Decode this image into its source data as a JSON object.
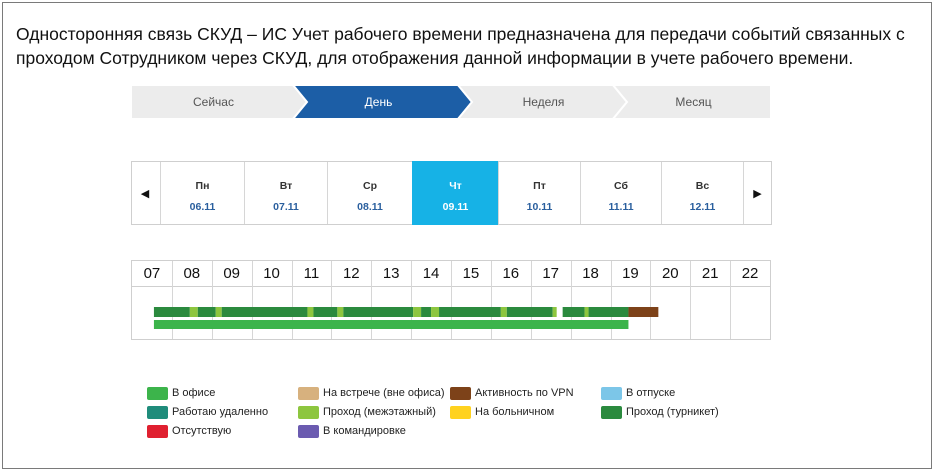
{
  "headline": "Односторонняя связь СКУД – ИС Учет рабочего времени предназначена для передачи событий связанных с проходом Сотрудником через СКУД, для отображения данной информации в учете рабочего времени.",
  "period_tabs": [
    {
      "label": "Сейчас",
      "active": false
    },
    {
      "label": "День",
      "active": true
    },
    {
      "label": "Неделя",
      "active": false
    },
    {
      "label": "Месяц",
      "active": false
    }
  ],
  "week": {
    "prev_icon": "triangle-left-icon",
    "next_icon": "triangle-right-icon",
    "days": [
      {
        "name": "Пн",
        "date": "06.11",
        "active": false
      },
      {
        "name": "Вт",
        "date": "07.11",
        "active": false
      },
      {
        "name": "Ср",
        "date": "08.11",
        "active": false
      },
      {
        "name": "Чт",
        "date": "09.11",
        "active": true
      },
      {
        "name": "Пт",
        "date": "10.11",
        "active": false
      },
      {
        "name": "Сб",
        "date": "11.11",
        "active": false
      },
      {
        "name": "Вс",
        "date": "12.11",
        "active": false
      }
    ]
  },
  "timeline": {
    "hours": [
      "07",
      "08",
      "09",
      "10",
      "11",
      "12",
      "13",
      "14",
      "15",
      "16",
      "17",
      "18",
      "19",
      "20",
      "21",
      "22"
    ],
    "segments_top": [
      {
        "type": "turnstile",
        "start": 7.05,
        "end": 7.95
      },
      {
        "type": "interfloor",
        "start": 7.95,
        "end": 8.15
      },
      {
        "type": "turnstile",
        "start": 8.15,
        "end": 8.6
      },
      {
        "type": "interfloor",
        "start": 8.6,
        "end": 8.75
      },
      {
        "type": "turnstile",
        "start": 8.75,
        "end": 10.9
      },
      {
        "type": "interfloor",
        "start": 10.9,
        "end": 11.05
      },
      {
        "type": "turnstile",
        "start": 11.05,
        "end": 11.65
      },
      {
        "type": "interfloor",
        "start": 11.65,
        "end": 11.8
      },
      {
        "type": "turnstile",
        "start": 11.8,
        "end": 13.55
      },
      {
        "type": "interfloor",
        "start": 13.55,
        "end": 13.75
      },
      {
        "type": "turnstile",
        "start": 13.75,
        "end": 14.0
      },
      {
        "type": "interfloor",
        "start": 14.0,
        "end": 14.2
      },
      {
        "type": "turnstile",
        "start": 14.2,
        "end": 15.75
      },
      {
        "type": "interfloor",
        "start": 15.75,
        "end": 15.9
      },
      {
        "type": "turnstile",
        "start": 15.9,
        "end": 17.05
      },
      {
        "type": "interfloor",
        "start": 17.05,
        "end": 17.15
      },
      {
        "type": "turnstile",
        "start": 17.3,
        "end": 17.85
      },
      {
        "type": "interfloor",
        "start": 17.85,
        "end": 17.95
      },
      {
        "type": "turnstile",
        "start": 17.95,
        "end": 18.95
      },
      {
        "type": "vpn",
        "start": 18.95,
        "end": 19.7
      }
    ],
    "segments_bottom": [
      {
        "type": "office",
        "start": 7.05,
        "end": 18.95
      }
    ]
  },
  "legend": [
    {
      "key": "office",
      "label": "В офисе",
      "color": "#3cb44b"
    },
    {
      "key": "meeting",
      "label": "На встрече (вне офиса)",
      "color": "#d7b17e"
    },
    {
      "key": "vpn",
      "label": "Активность по VPN",
      "color": "#7d4219"
    },
    {
      "key": "vacation",
      "label": "В отпуске",
      "color": "#7cc6e8"
    },
    {
      "key": "remote",
      "label": "Работаю удаленно",
      "color": "#1f8c7b"
    },
    {
      "key": "interfloor",
      "label": "Проход (межэтажный)",
      "color": "#8dc63f"
    },
    {
      "key": "sick",
      "label": "На больничном",
      "color": "#ffd21f"
    },
    {
      "key": "turnstile",
      "label": "Проход (турникет)",
      "color": "#2b8a3e"
    },
    {
      "key": "absent",
      "label": "Отсутствую",
      "color": "#e02030"
    },
    {
      "key": "business_trip",
      "label": "В командировке",
      "color": "#6b5bb0"
    }
  ],
  "colors": {
    "tab_active": "#1c5ea6",
    "tab_inactive": "#ececec",
    "day_active": "#16b2e6"
  }
}
